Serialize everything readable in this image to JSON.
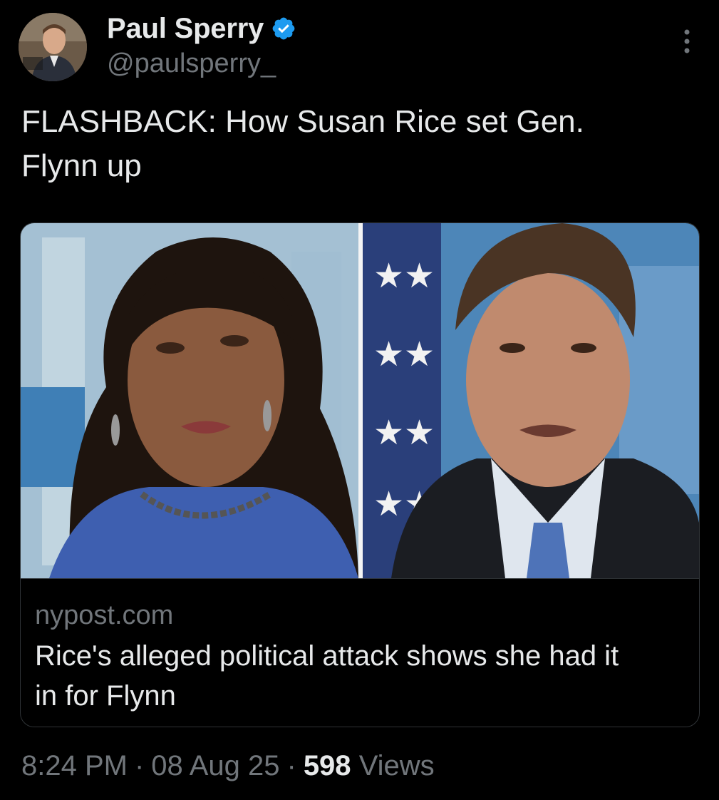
{
  "author": {
    "name": "Paul Sperry",
    "handle": "@paulsperry_",
    "verified": true,
    "verified_color": "#1d9bf0"
  },
  "tweet": {
    "text_line1": "FLASHBACK: How Susan Rice set Gen.",
    "text_line2": "Flynn up"
  },
  "card": {
    "domain": "nypost.com",
    "title_line1": "Rice's alleged political attack shows she had it",
    "title_line2": "in for Flynn"
  },
  "meta": {
    "time": "8:24 PM",
    "separator": "·",
    "date": "08 Aug 25",
    "views_count": "598",
    "views_label": "Views"
  },
  "icons": {
    "more": "more-options-icon",
    "verified": "verified-badge-icon"
  },
  "colors": {
    "background": "#000000",
    "text_primary": "#e7e9ea",
    "text_secondary": "#71767b",
    "border": "#2f3336"
  }
}
